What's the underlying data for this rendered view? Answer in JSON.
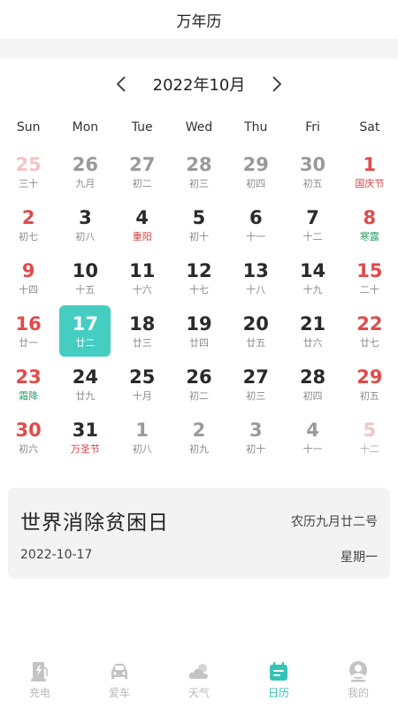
{
  "header": {
    "title": "万年历"
  },
  "calendar": {
    "month_label": "2022年10月",
    "prev_icon": "chevron-left-icon",
    "next_icon": "chevron-right-icon",
    "weekdays": [
      "Sun",
      "Mon",
      "Tue",
      "Wed",
      "Thu",
      "Fri",
      "Sat"
    ],
    "selected_day": "17",
    "days": [
      {
        "day": "25",
        "lunar": "三十",
        "in_month": false,
        "weekend": true,
        "lunar_type": "normal"
      },
      {
        "day": "26",
        "lunar": "九月",
        "in_month": false,
        "weekend": false,
        "lunar_type": "normal"
      },
      {
        "day": "27",
        "lunar": "初二",
        "in_month": false,
        "weekend": false,
        "lunar_type": "normal"
      },
      {
        "day": "28",
        "lunar": "初三",
        "in_month": false,
        "weekend": false,
        "lunar_type": "normal"
      },
      {
        "day": "29",
        "lunar": "初四",
        "in_month": false,
        "weekend": false,
        "lunar_type": "normal"
      },
      {
        "day": "30",
        "lunar": "初五",
        "in_month": false,
        "weekend": false,
        "lunar_type": "normal"
      },
      {
        "day": "1",
        "lunar": "国庆节",
        "in_month": true,
        "weekend": true,
        "lunar_type": "festival"
      },
      {
        "day": "2",
        "lunar": "初七",
        "in_month": true,
        "weekend": true,
        "lunar_type": "normal"
      },
      {
        "day": "3",
        "lunar": "初八",
        "in_month": true,
        "weekend": false,
        "lunar_type": "normal"
      },
      {
        "day": "4",
        "lunar": "重阳",
        "in_month": true,
        "weekend": false,
        "lunar_type": "festival"
      },
      {
        "day": "5",
        "lunar": "初十",
        "in_month": true,
        "weekend": false,
        "lunar_type": "normal"
      },
      {
        "day": "6",
        "lunar": "十一",
        "in_month": true,
        "weekend": false,
        "lunar_type": "normal"
      },
      {
        "day": "7",
        "lunar": "十二",
        "in_month": true,
        "weekend": false,
        "lunar_type": "normal"
      },
      {
        "day": "8",
        "lunar": "寒露",
        "in_month": true,
        "weekend": true,
        "lunar_type": "solar"
      },
      {
        "day": "9",
        "lunar": "十四",
        "in_month": true,
        "weekend": true,
        "lunar_type": "normal"
      },
      {
        "day": "10",
        "lunar": "十五",
        "in_month": true,
        "weekend": false,
        "lunar_type": "normal"
      },
      {
        "day": "11",
        "lunar": "十六",
        "in_month": true,
        "weekend": false,
        "lunar_type": "normal"
      },
      {
        "day": "12",
        "lunar": "十七",
        "in_month": true,
        "weekend": false,
        "lunar_type": "normal"
      },
      {
        "day": "13",
        "lunar": "十八",
        "in_month": true,
        "weekend": false,
        "lunar_type": "normal"
      },
      {
        "day": "14",
        "lunar": "十九",
        "in_month": true,
        "weekend": false,
        "lunar_type": "normal"
      },
      {
        "day": "15",
        "lunar": "二十",
        "in_month": true,
        "weekend": true,
        "lunar_type": "normal"
      },
      {
        "day": "16",
        "lunar": "廿一",
        "in_month": true,
        "weekend": true,
        "lunar_type": "normal"
      },
      {
        "day": "17",
        "lunar": "廿二",
        "in_month": true,
        "weekend": false,
        "lunar_type": "normal"
      },
      {
        "day": "18",
        "lunar": "廿三",
        "in_month": true,
        "weekend": false,
        "lunar_type": "normal"
      },
      {
        "day": "19",
        "lunar": "廿四",
        "in_month": true,
        "weekend": false,
        "lunar_type": "normal"
      },
      {
        "day": "20",
        "lunar": "廿五",
        "in_month": true,
        "weekend": false,
        "lunar_type": "normal"
      },
      {
        "day": "21",
        "lunar": "廿六",
        "in_month": true,
        "weekend": false,
        "lunar_type": "normal"
      },
      {
        "day": "22",
        "lunar": "廿七",
        "in_month": true,
        "weekend": true,
        "lunar_type": "normal"
      },
      {
        "day": "23",
        "lunar": "霜降",
        "in_month": true,
        "weekend": true,
        "lunar_type": "solar"
      },
      {
        "day": "24",
        "lunar": "廿九",
        "in_month": true,
        "weekend": false,
        "lunar_type": "normal"
      },
      {
        "day": "25",
        "lunar": "十月",
        "in_month": true,
        "weekend": false,
        "lunar_type": "normal"
      },
      {
        "day": "26",
        "lunar": "初二",
        "in_month": true,
        "weekend": false,
        "lunar_type": "normal"
      },
      {
        "day": "27",
        "lunar": "初三",
        "in_month": true,
        "weekend": false,
        "lunar_type": "normal"
      },
      {
        "day": "28",
        "lunar": "初四",
        "in_month": true,
        "weekend": false,
        "lunar_type": "normal"
      },
      {
        "day": "29",
        "lunar": "初五",
        "in_month": true,
        "weekend": true,
        "lunar_type": "normal"
      },
      {
        "day": "30",
        "lunar": "初六",
        "in_month": true,
        "weekend": true,
        "lunar_type": "normal"
      },
      {
        "day": "31",
        "lunar": "万圣节",
        "in_month": true,
        "weekend": false,
        "lunar_type": "festival"
      },
      {
        "day": "1",
        "lunar": "初八",
        "in_month": false,
        "weekend": false,
        "lunar_type": "normal"
      },
      {
        "day": "2",
        "lunar": "初九",
        "in_month": false,
        "weekend": false,
        "lunar_type": "normal"
      },
      {
        "day": "3",
        "lunar": "初十",
        "in_month": false,
        "weekend": false,
        "lunar_type": "normal"
      },
      {
        "day": "4",
        "lunar": "十一",
        "in_month": false,
        "weekend": false,
        "lunar_type": "normal"
      },
      {
        "day": "5",
        "lunar": "十二",
        "in_month": false,
        "weekend": true,
        "lunar_type": "normal"
      }
    ]
  },
  "event": {
    "title": "世界消除贫困日",
    "lunar_date": "农历九月廿二号",
    "date": "2022-10-17",
    "weekday": "星期一"
  },
  "colors": {
    "accent": "#45cdc1",
    "weekend": "#e04b4b",
    "solar_term": "#2da06a",
    "tab_inactive": "#b8b8b8"
  },
  "tabbar": {
    "tabs": [
      {
        "label": "充电",
        "icon": "charging-station-icon",
        "active": false
      },
      {
        "label": "爱车",
        "icon": "car-icon",
        "active": false
      },
      {
        "label": "天气",
        "icon": "weather-cloud-icon",
        "active": false
      },
      {
        "label": "日历",
        "icon": "calendar-icon",
        "active": true
      },
      {
        "label": "我的",
        "icon": "user-icon",
        "active": false
      }
    ]
  }
}
